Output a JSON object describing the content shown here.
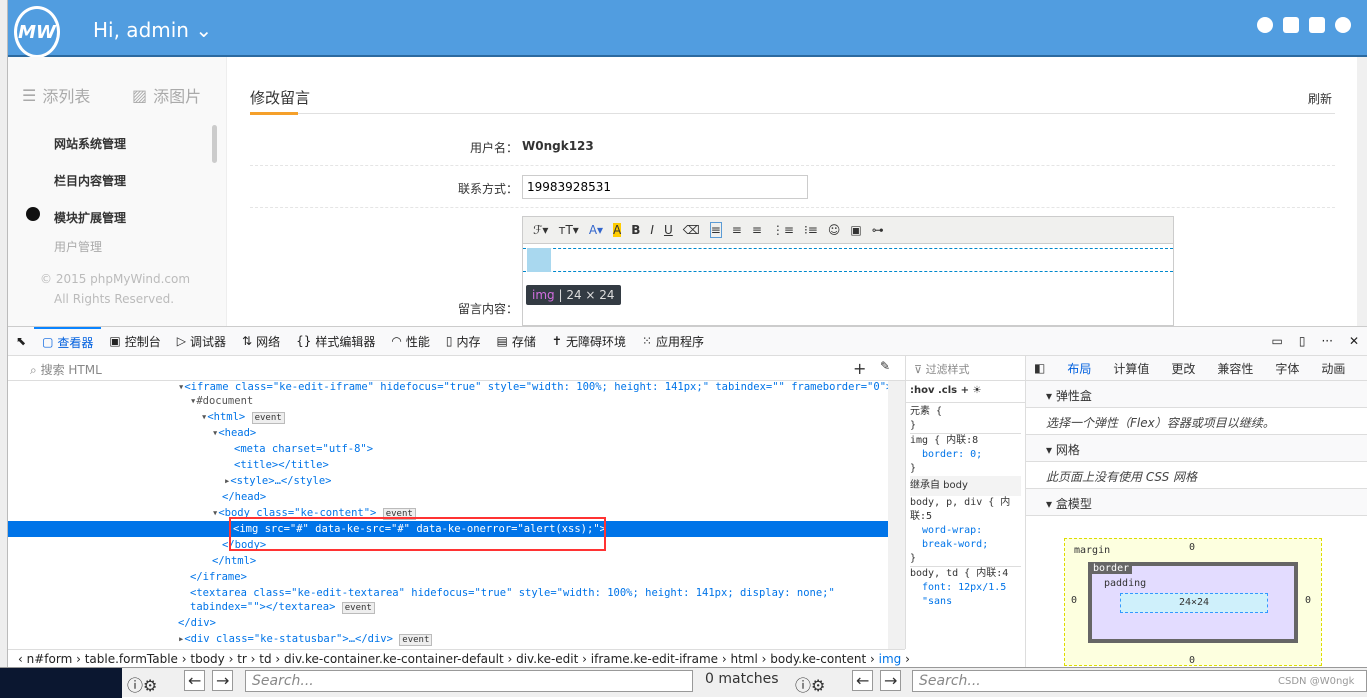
{
  "header": {
    "logo": "MW",
    "greeting": "Hi, admin",
    "icons": [
      "message-icon",
      "monitor-icon",
      "grid-icon",
      "help-icon"
    ]
  },
  "sidebar": {
    "tab_list": "添列表",
    "tab_image": "添图片",
    "items": [
      "网站系统管理",
      "栏目内容管理",
      "模块扩展管理"
    ],
    "sub_item": "用户管理",
    "copyright": "© 2015 phpMyWind.com",
    "rights": "All Rights Reserved."
  },
  "main": {
    "title": "修改留言",
    "refresh": "刷新",
    "username_label": "用户名：",
    "username": "W0ngk123",
    "contact_label": "联系方式：",
    "contact_value": "19983928531",
    "content_label": "留言内容：",
    "tooltip_tag": "img",
    "tooltip_size": "24 × 24",
    "accent": "#f5a02a"
  },
  "devtools": {
    "tabs": [
      "查看器",
      "控制台",
      "调试器",
      "网络",
      "样式编辑器",
      "性能",
      "内存",
      "存储",
      "无障碍环境",
      "应用程序"
    ],
    "search_placeholder": "搜索 HTML",
    "tree": [
      "<iframe class=\"ke-edit-iframe\" hidefocus=\"true\" style=\"width: 100%; height: 141px;\" tabindex=\"\" frameborder=\"0\">",
      "#document",
      "<html>",
      "<head>",
      "<meta charset=\"utf-8\">",
      "<title></title>",
      "<style>…</style>",
      "</head>",
      "<body class=\"ke-content\">",
      "<img src=\"#\" data-ke-src=\"#\" data-ke-onerror=\"alert(xss);\">",
      "</body>",
      "</html>",
      "</iframe>",
      "<textarea class=\"ke-edit-textarea\" hidefocus=\"true\" style=\"width: 100%; height: 141px; display: none;\"",
      "tabindex=\"\"></textarea>",
      "</div>",
      "<div class=\"ke-statusbar\">…</div>"
    ],
    "event_badge": "event",
    "styles": {
      "filter": "过滤样式",
      "hov": ":hov",
      "cls": ".cls",
      "rules": [
        "元素 {",
        "}",
        "img { 内联:8",
        "border: 0;",
        "}",
        "继承自 body",
        "body, p, div { 内联:5",
        "word-wrap: break-word;",
        "}",
        "body, td { 内联:4",
        "font: 12px/1.5 \"sans"
      ]
    },
    "layout_tabs": [
      "布局",
      "计算值",
      "更改",
      "兼容性",
      "字体",
      "动画"
    ],
    "flex_title": "弹性盒",
    "flex_note": "选择一个弹性（Flex）容器或项目以继续。",
    "grid_title": "网格",
    "grid_note": "此页面上没有使用 CSS 网格",
    "box_title": "盒模型",
    "box": {
      "margin": "margin",
      "border": "border",
      "padding": "padding",
      "size": "24×24",
      "zero": "0"
    },
    "breadcrumb": [
      "n#form",
      "table.formTable",
      "tbody",
      "tr",
      "td",
      "div.ke-container.ke-container-default",
      "div.ke-edit",
      "iframe.ke-edit-iframe",
      "html",
      "body.ke-content",
      "img"
    ]
  },
  "findbar": {
    "placeholder": "Search...",
    "matches": "0 matches",
    "placeholder2": "Search...",
    "watermark": "CSDN @W0ngk"
  }
}
